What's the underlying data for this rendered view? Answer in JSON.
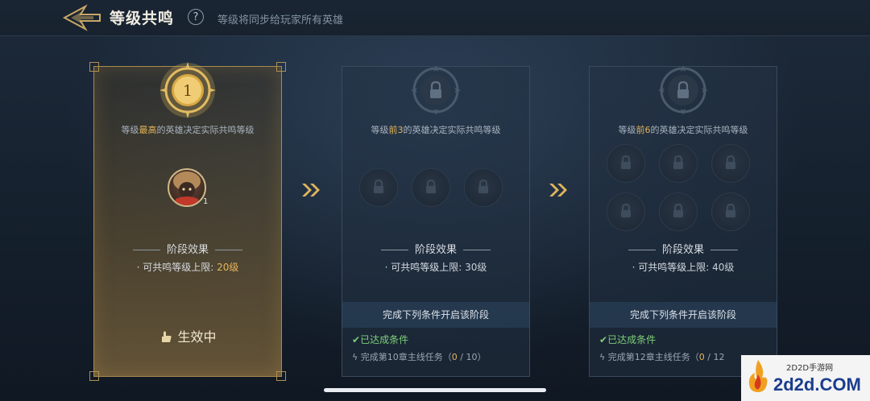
{
  "header": {
    "title": "等级共鸣",
    "help_label": "?",
    "subtitle": "等级将同步给玩家所有英雄"
  },
  "stages": [
    {
      "emblem_number": "1",
      "requirement_prefix": "等级",
      "requirement_highlight": "最高",
      "requirement_suffix": "的英雄决定实际共鸣等级",
      "hero_level": "1",
      "effect_title": "阶段效果",
      "effect_label": "· 可共鸣等级上限: ",
      "effect_value": "20级",
      "state_label": "生效中"
    },
    {
      "requirement_prefix": "等级",
      "requirement_highlight": "前3",
      "requirement_suffix": "的英雄决定实际共鸣等级",
      "effect_title": "阶段效果",
      "effect_label": "· 可共鸣等级上限: ",
      "effect_value": "30级",
      "condition_header": "完成下列条件开启该阶段",
      "condition_done": "已达成条件",
      "task_prefix": "完成第10章主线任务（",
      "task_progress": "0",
      "task_suffix": " / 10）"
    },
    {
      "requirement_prefix": "等级",
      "requirement_highlight": "前6",
      "requirement_suffix": "的英雄决定实际共鸣等级",
      "effect_title": "阶段效果",
      "effect_label": "· 可共鸣等级上限: ",
      "effect_value": "40级",
      "condition_header": "完成下列条件开启该阶段",
      "condition_done": "已达成条件",
      "task_prefix": "完成第12章主线任务（",
      "task_progress": "0",
      "task_suffix": " / 12"
    }
  ],
  "watermark": {
    "small": "2D2D手游网",
    "big": "2d2d.COM"
  },
  "colors": {
    "gold": "#e3b55a",
    "done_green": "#7fcf7a"
  }
}
